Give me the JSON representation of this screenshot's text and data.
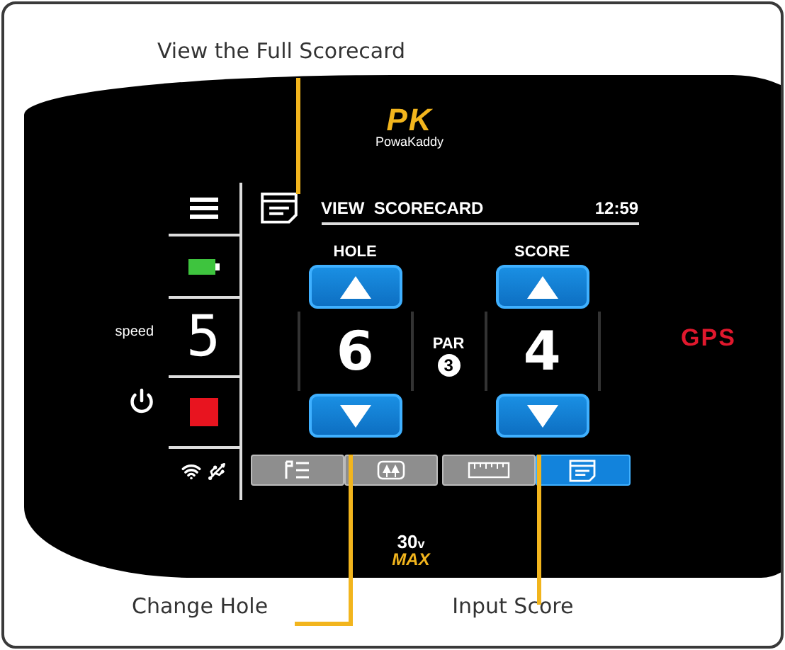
{
  "callouts": {
    "top": "View the Full Scorecard",
    "bottom_left": "Change Hole",
    "bottom_right": "Input Score"
  },
  "logo": {
    "mark": "PK",
    "name": "PowaKaddy"
  },
  "status": {
    "speed_label": "speed",
    "speed": "5"
  },
  "header": {
    "title": "VIEW  SCORECARD",
    "time": "12:59"
  },
  "counters": [
    {
      "label": "HOLE",
      "value": "6"
    },
    {
      "label": "SCORE",
      "value": "4"
    }
  ],
  "par": {
    "label": "PAR",
    "value": "3"
  },
  "tabs": [
    {
      "kind": "flag-list",
      "selected": false
    },
    {
      "kind": "trees",
      "selected": false
    },
    {
      "kind": "ruler",
      "selected": false
    },
    {
      "kind": "scorecard",
      "selected": true
    }
  ],
  "gps": "GPS",
  "model": {
    "voltage": "30",
    "unit": "v",
    "name": "MAX"
  }
}
